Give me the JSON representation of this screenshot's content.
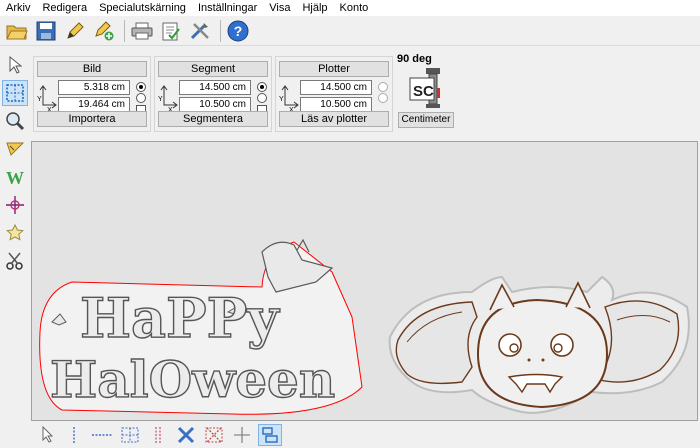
{
  "menu": [
    "Arkiv",
    "Redigera",
    "Specialutskärning",
    "Inställningar",
    "Visa",
    "Hjälp",
    "Konto"
  ],
  "toolbar_icons": [
    "open-folder-icon",
    "save-icon",
    "pen-icon",
    "add-pen-icon",
    "print-icon",
    "checklist-icon",
    "tools-icon",
    "help-icon"
  ],
  "left_tools": [
    "pointer-icon",
    "select-rect-icon",
    "zoom-icon",
    "wand-icon",
    "weed-icon",
    "crosshair-icon",
    "star-icon",
    "scissors-icon"
  ],
  "panels": {
    "bild": {
      "title": "Bild",
      "x_value": "5.318 cm",
      "y_value": "19.464 cm",
      "button": "Importera"
    },
    "segment": {
      "title": "Segment",
      "x_value": "14.500 cm",
      "y_value": "10.500 cm",
      "button": "Segmentera"
    },
    "plotter": {
      "title": "Plotter",
      "x_value": "14.500 cm",
      "y_value": "10.500 cm",
      "button": "Läs av plotter"
    }
  },
  "axis_labels": {
    "x": "X",
    "y": "Y"
  },
  "rotation": "90 deg",
  "logo_text": "SC",
  "units_button": "Centimeter",
  "artwork": {
    "halloween_line1": "HaPPy",
    "halloween_line2": "HalOween"
  },
  "bottom_tools": [
    "pointer-icon",
    "vline-dashed-icon",
    "hline-dashed-icon",
    "rect-dashed-icon",
    "double-vline-icon",
    "x-icon",
    "x-dashed-icon",
    "cross-icon",
    "stack-rect-icon"
  ],
  "colors": {
    "cut_outline": "#ff0000",
    "design_fill": "#f2f2f2",
    "bat_stroke": "#7a3b1a",
    "accent": "#cce4f7"
  }
}
